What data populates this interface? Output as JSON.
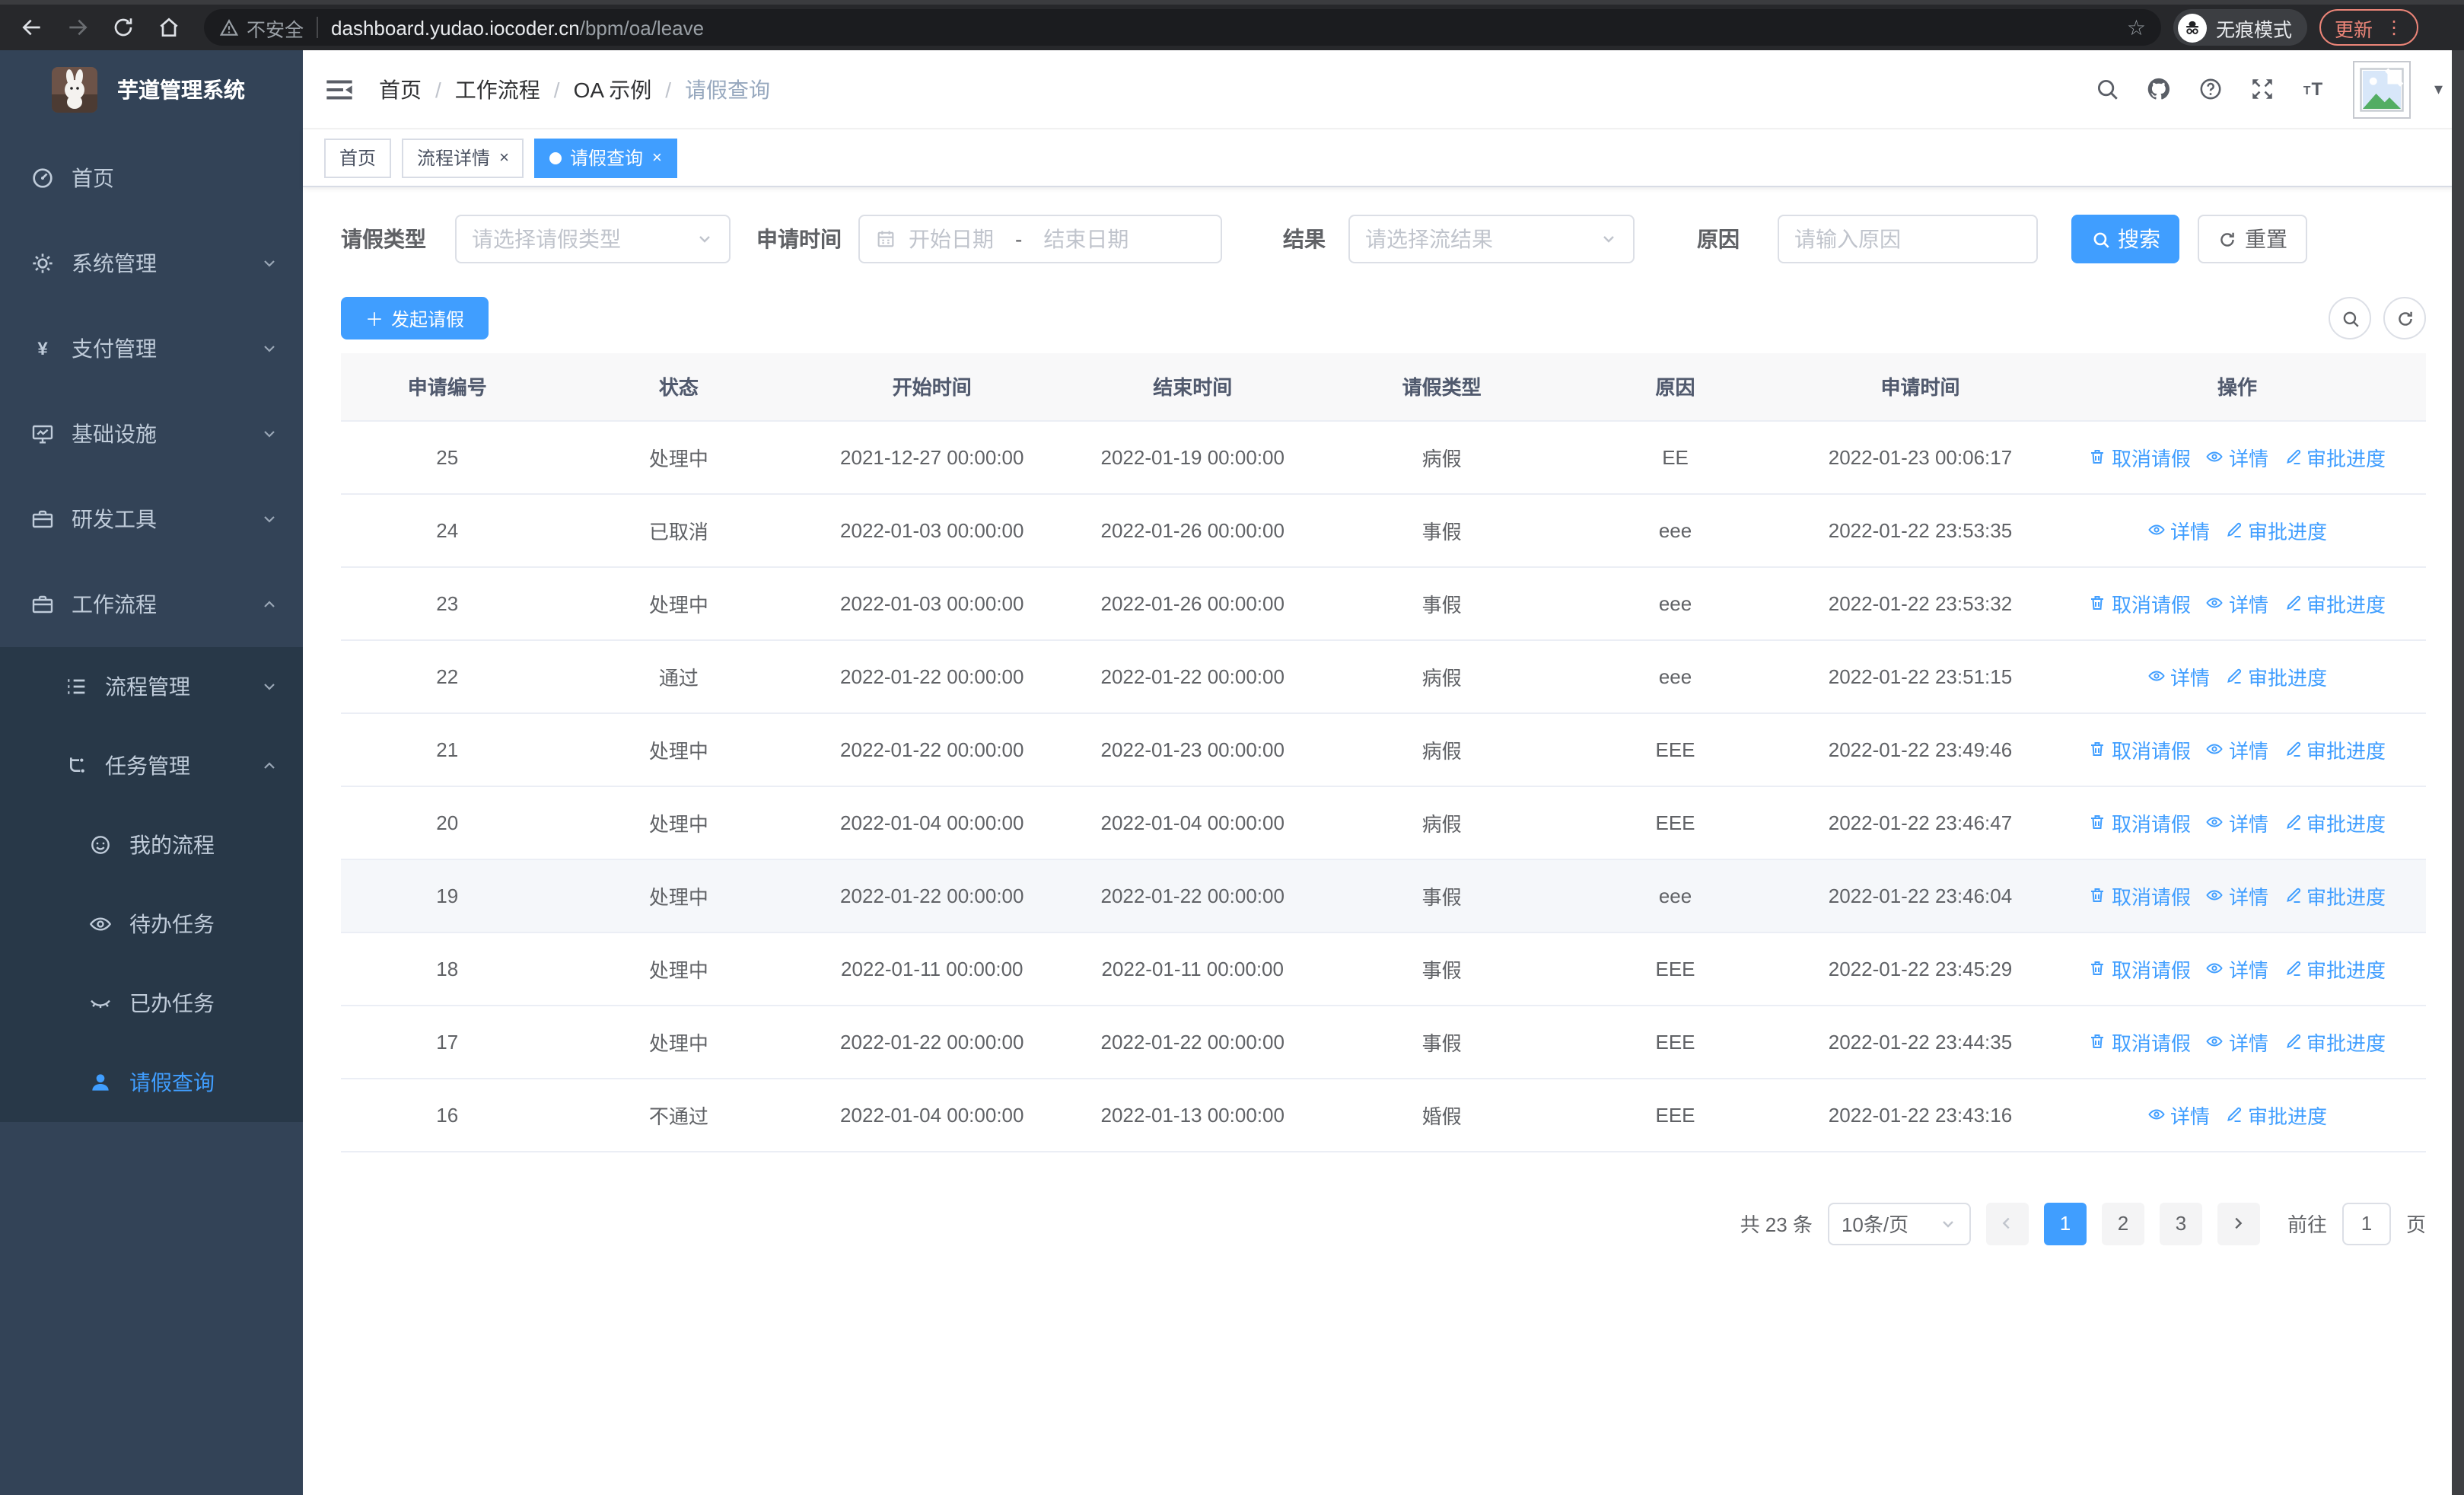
{
  "browser": {
    "security_label": "不安全",
    "url_host": "dashboard.yudao.iocoder.cn",
    "url_path": "/bpm/oa/leave",
    "incognito_label": "无痕模式",
    "update_label": "更新",
    "menu_dots": "⋮",
    "bookmark_star": "☆"
  },
  "sidebar": {
    "title": "芋道管理系统",
    "items": [
      {
        "key": "home",
        "label": "首页",
        "icon": "dashboard",
        "level": 1,
        "arrow": null,
        "sub": false,
        "active": false
      },
      {
        "key": "system",
        "label": "系统管理",
        "icon": "gear",
        "level": 1,
        "arrow": "down",
        "sub": false,
        "active": false
      },
      {
        "key": "payment",
        "label": "支付管理",
        "icon": "yen",
        "level": 1,
        "arrow": "down",
        "sub": false,
        "active": false
      },
      {
        "key": "infra",
        "label": "基础设施",
        "icon": "monitor",
        "level": 1,
        "arrow": "down",
        "sub": false,
        "active": false
      },
      {
        "key": "devtools",
        "label": "研发工具",
        "icon": "briefcase",
        "level": 1,
        "arrow": "down",
        "sub": false,
        "active": false
      },
      {
        "key": "workflow",
        "label": "工作流程",
        "icon": "briefcase",
        "level": 1,
        "arrow": "up",
        "sub": false,
        "active": false
      },
      {
        "key": "process-mgmt",
        "label": "流程管理",
        "icon": "process-list",
        "level": 2,
        "arrow": "down",
        "sub": true,
        "active": false
      },
      {
        "key": "task-mgmt",
        "label": "任务管理",
        "icon": "task-tree",
        "level": 2,
        "arrow": "up",
        "sub": true,
        "active": false
      },
      {
        "key": "my-process",
        "label": "我的流程",
        "icon": "robot",
        "level": 3,
        "arrow": null,
        "sub": true,
        "active": false
      },
      {
        "key": "todo-task",
        "label": "待办任务",
        "icon": "eye-open",
        "level": 3,
        "arrow": null,
        "sub": true,
        "active": false
      },
      {
        "key": "done-task",
        "label": "已办任务",
        "icon": "eye-closed",
        "level": 3,
        "arrow": null,
        "sub": true,
        "active": false
      },
      {
        "key": "leave-query",
        "label": "请假查询",
        "icon": "user",
        "level": 3,
        "arrow": null,
        "sub": true,
        "active": true
      }
    ]
  },
  "header": {
    "breadcrumb": [
      "首页",
      "工作流程",
      "OA 示例",
      "请假查询"
    ]
  },
  "tabs": [
    {
      "label": "首页",
      "closable": false,
      "active": false
    },
    {
      "label": "流程详情",
      "closable": true,
      "active": false
    },
    {
      "label": "请假查询",
      "closable": true,
      "active": true
    }
  ],
  "filters": {
    "leave_type_label": "请假类型",
    "leave_type_placeholder": "请选择请假类型",
    "apply_time_label": "申请时间",
    "date_start_placeholder": "开始日期",
    "date_separator": "-",
    "date_end_placeholder": "结束日期",
    "result_label": "结果",
    "result_placeholder": "请选择流结果",
    "reason_label": "原因",
    "reason_placeholder": "请输入原因",
    "search_label": "搜索",
    "reset_label": "重置"
  },
  "toolbar": {
    "create_label": "发起请假"
  },
  "table": {
    "columns": [
      "申请编号",
      "状态",
      "开始时间",
      "结束时间",
      "请假类型",
      "原因",
      "申请时间",
      "操作"
    ],
    "action_cancel": "取消请假",
    "action_detail": "详情",
    "action_progress": "审批进度",
    "rows": [
      {
        "id": "25",
        "status": "处理中",
        "start": "2021-12-27 00:00:00",
        "end": "2022-01-19 00:00:00",
        "type": "病假",
        "reason": "EE",
        "applied": "2022-01-23 00:06:17",
        "cancelable": true,
        "hover": false
      },
      {
        "id": "24",
        "status": "已取消",
        "start": "2022-01-03 00:00:00",
        "end": "2022-01-26 00:00:00",
        "type": "事假",
        "reason": "eee",
        "applied": "2022-01-22 23:53:35",
        "cancelable": false,
        "hover": false
      },
      {
        "id": "23",
        "status": "处理中",
        "start": "2022-01-03 00:00:00",
        "end": "2022-01-26 00:00:00",
        "type": "事假",
        "reason": "eee",
        "applied": "2022-01-22 23:53:32",
        "cancelable": true,
        "hover": false
      },
      {
        "id": "22",
        "status": "通过",
        "start": "2022-01-22 00:00:00",
        "end": "2022-01-22 00:00:00",
        "type": "病假",
        "reason": "eee",
        "applied": "2022-01-22 23:51:15",
        "cancelable": false,
        "hover": false
      },
      {
        "id": "21",
        "status": "处理中",
        "start": "2022-01-22 00:00:00",
        "end": "2022-01-23 00:00:00",
        "type": "病假",
        "reason": "EEE",
        "applied": "2022-01-22 23:49:46",
        "cancelable": true,
        "hover": false
      },
      {
        "id": "20",
        "status": "处理中",
        "start": "2022-01-04 00:00:00",
        "end": "2022-01-04 00:00:00",
        "type": "病假",
        "reason": "EEE",
        "applied": "2022-01-22 23:46:47",
        "cancelable": true,
        "hover": false
      },
      {
        "id": "19",
        "status": "处理中",
        "start": "2022-01-22 00:00:00",
        "end": "2022-01-22 00:00:00",
        "type": "事假",
        "reason": "eee",
        "applied": "2022-01-22 23:46:04",
        "cancelable": true,
        "hover": true
      },
      {
        "id": "18",
        "status": "处理中",
        "start": "2022-01-11 00:00:00",
        "end": "2022-01-11 00:00:00",
        "type": "事假",
        "reason": "EEE",
        "applied": "2022-01-22 23:45:29",
        "cancelable": true,
        "hover": false
      },
      {
        "id": "17",
        "status": "处理中",
        "start": "2022-01-22 00:00:00",
        "end": "2022-01-22 00:00:00",
        "type": "事假",
        "reason": "EEE",
        "applied": "2022-01-22 23:44:35",
        "cancelable": true,
        "hover": false
      },
      {
        "id": "16",
        "status": "不通过",
        "start": "2022-01-04 00:00:00",
        "end": "2022-01-13 00:00:00",
        "type": "婚假",
        "reason": "EEE",
        "applied": "2022-01-22 23:43:16",
        "cancelable": false,
        "hover": false
      }
    ]
  },
  "pagination": {
    "total_label": "共 23 条",
    "page_size_value": "10条/页",
    "pages": [
      "1",
      "2",
      "3"
    ],
    "active_page": "1",
    "goto_label": "前往",
    "goto_value": "1",
    "page_unit": "页"
  },
  "colors": {
    "accent": "#409EFF",
    "sidebar_bg": "#334357",
    "submenu_bg": "#283848"
  }
}
